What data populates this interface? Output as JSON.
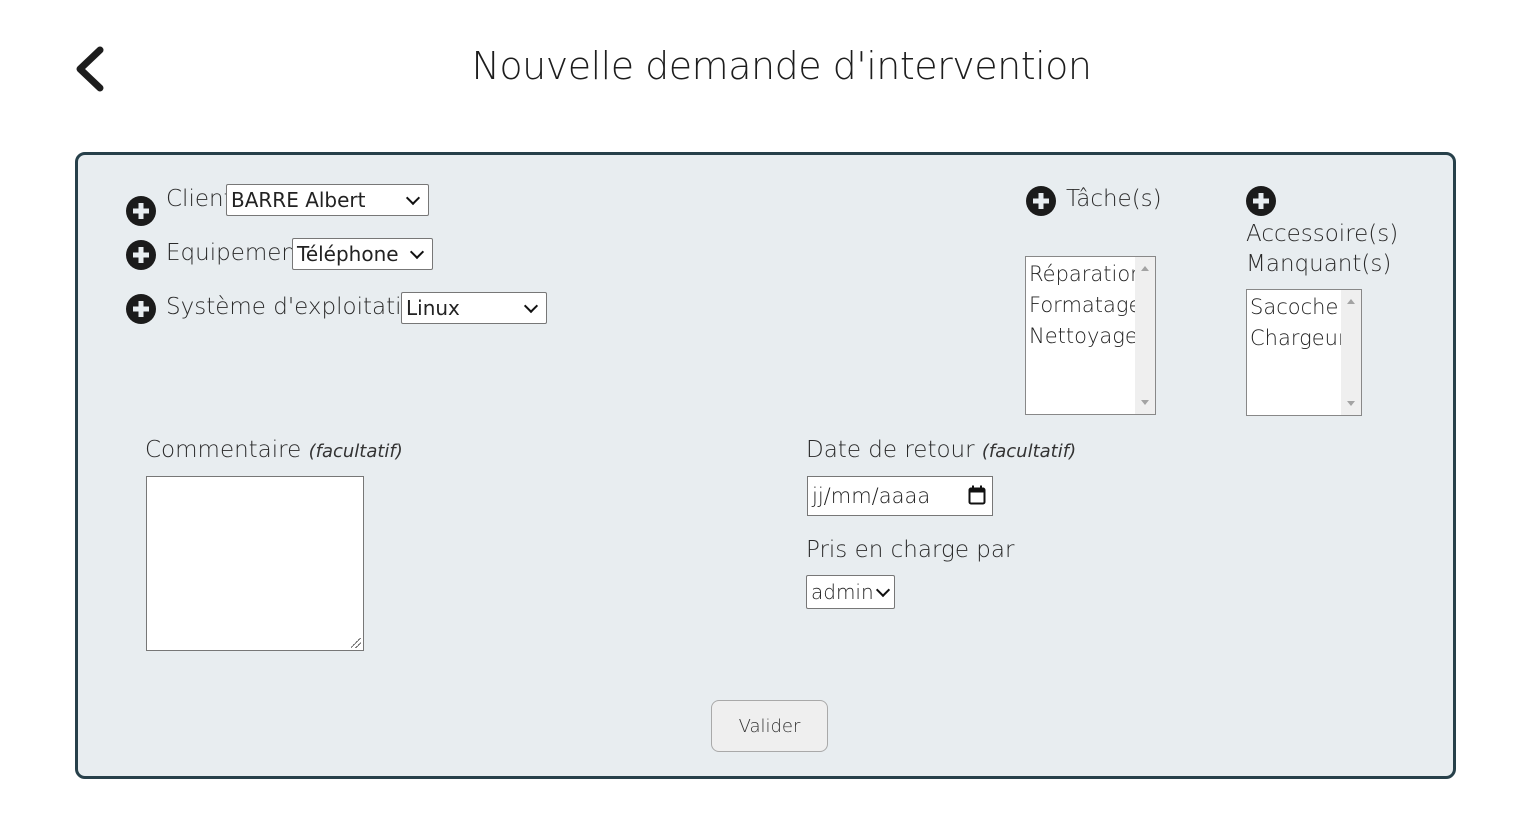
{
  "header": {
    "title": "Nouvelle demande d'intervention",
    "back_icon": "chevron-left-icon"
  },
  "form": {
    "client": {
      "label": "Client",
      "value": "BARRE Albert"
    },
    "equipement": {
      "label": "Equipement",
      "value": "Téléphone"
    },
    "systeme": {
      "label": "Système d'exploitation",
      "value": "Linux"
    },
    "taches": {
      "label": "Tâche(s)",
      "options": [
        "Réparation",
        "Formatage",
        "Nettoyage"
      ]
    },
    "accessoires": {
      "label_line1": "Accessoire(s)",
      "label_line2": "Manquant(s)",
      "options": [
        "Sacoche",
        "Chargeur"
      ]
    },
    "commentaire": {
      "label": "Commentaire",
      "hint": "(facultatif)",
      "value": ""
    },
    "date_retour": {
      "label": "Date de retour",
      "hint": "(facultatif)",
      "placeholder": "jj/mm/aaaa"
    },
    "pris_en_charge": {
      "label": "Pris en charge par",
      "value": "admin"
    },
    "submit_label": "Valider"
  },
  "colors": {
    "card_bg": "#e8edf0",
    "card_border": "#27404a",
    "icon": "#1b1b1b"
  }
}
